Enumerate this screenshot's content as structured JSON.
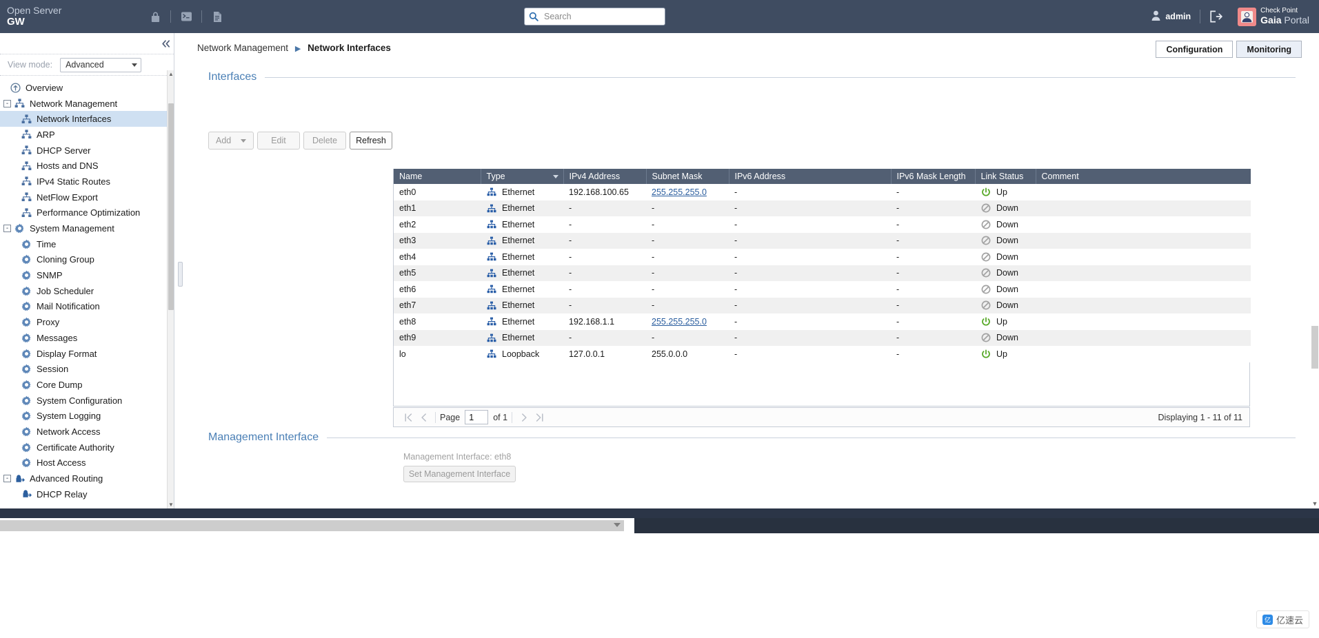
{
  "header": {
    "brand_line1": "Open Server",
    "brand_line2": "GW",
    "icons": [
      "lock-icon",
      "terminal-icon",
      "document-icon"
    ],
    "search": {
      "placeholder": "Search",
      "value": ""
    },
    "user": "admin",
    "logout_icon": "logout-icon",
    "logo": {
      "line1": "Check Point",
      "line2_bold": "Gaia",
      "line2_light": " Portal"
    },
    "bg_color": "#3f4c61"
  },
  "sidebar": {
    "collapse_icon": "collapse-left-icon",
    "view_mode": {
      "label": "View mode:",
      "value": "Advanced"
    },
    "items": [
      {
        "label": "Overview",
        "level": "root",
        "icon": "overview-icon",
        "expander": null,
        "selected": false
      },
      {
        "label": "Network Management",
        "level": "group",
        "icon": "network-icon",
        "expander": "-",
        "selected": false
      },
      {
        "label": "Network Interfaces",
        "level": "child",
        "icon": "network-icon",
        "expander": null,
        "selected": true
      },
      {
        "label": "ARP",
        "level": "child",
        "icon": "network-icon",
        "expander": null,
        "selected": false
      },
      {
        "label": "DHCP Server",
        "level": "child",
        "icon": "network-icon",
        "expander": null,
        "selected": false
      },
      {
        "label": "Hosts and DNS",
        "level": "child",
        "icon": "network-icon",
        "expander": null,
        "selected": false
      },
      {
        "label": "IPv4 Static Routes",
        "level": "child",
        "icon": "network-icon",
        "expander": null,
        "selected": false
      },
      {
        "label": "NetFlow Export",
        "level": "child",
        "icon": "network-icon",
        "expander": null,
        "selected": false
      },
      {
        "label": "Performance Optimization",
        "level": "child",
        "icon": "network-icon",
        "expander": null,
        "selected": false
      },
      {
        "label": "System Management",
        "level": "group",
        "icon": "gear-icon",
        "expander": "-",
        "selected": false
      },
      {
        "label": "Time",
        "level": "child",
        "icon": "gear-icon",
        "expander": null,
        "selected": false
      },
      {
        "label": "Cloning Group",
        "level": "child",
        "icon": "gear-icon",
        "expander": null,
        "selected": false
      },
      {
        "label": "SNMP",
        "level": "child",
        "icon": "gear-icon",
        "expander": null,
        "selected": false
      },
      {
        "label": "Job Scheduler",
        "level": "child",
        "icon": "gear-icon",
        "expander": null,
        "selected": false
      },
      {
        "label": "Mail Notification",
        "level": "child",
        "icon": "gear-icon",
        "expander": null,
        "selected": false
      },
      {
        "label": "Proxy",
        "level": "child",
        "icon": "gear-icon",
        "expander": null,
        "selected": false
      },
      {
        "label": "Messages",
        "level": "child",
        "icon": "gear-icon",
        "expander": null,
        "selected": false
      },
      {
        "label": "Display Format",
        "level": "child",
        "icon": "gear-icon",
        "expander": null,
        "selected": false
      },
      {
        "label": "Session",
        "level": "child",
        "icon": "gear-icon",
        "expander": null,
        "selected": false
      },
      {
        "label": "Core Dump",
        "level": "child",
        "icon": "gear-icon",
        "expander": null,
        "selected": false
      },
      {
        "label": "System Configuration",
        "level": "child",
        "icon": "gear-icon",
        "expander": null,
        "selected": false
      },
      {
        "label": "System Logging",
        "level": "child",
        "icon": "gear-icon",
        "expander": null,
        "selected": false
      },
      {
        "label": "Network Access",
        "level": "child",
        "icon": "gear-icon",
        "expander": null,
        "selected": false
      },
      {
        "label": "Certificate Authority",
        "level": "child",
        "icon": "gear-icon",
        "expander": null,
        "selected": false
      },
      {
        "label": "Host Access",
        "level": "child",
        "icon": "gear-icon",
        "expander": null,
        "selected": false
      },
      {
        "label": "Advanced Routing",
        "level": "group",
        "icon": "routing-lock-icon",
        "expander": "-",
        "selected": false
      },
      {
        "label": "DHCP Relay",
        "level": "child",
        "icon": "routing-lock-icon",
        "expander": null,
        "selected": false
      }
    ]
  },
  "main": {
    "breadcrumb": {
      "parent": "Network Management",
      "current": "Network Interfaces"
    },
    "mode_buttons": [
      {
        "label": "Configuration",
        "active": false
      },
      {
        "label": "Monitoring",
        "active": true
      }
    ],
    "interfaces_section": {
      "title": "Interfaces",
      "toolbar": [
        {
          "label": "Add",
          "enabled": false,
          "has_caret": true
        },
        {
          "label": "Edit",
          "enabled": false,
          "has_caret": false
        },
        {
          "label": "Delete",
          "enabled": false,
          "has_caret": false
        },
        {
          "label": "Refresh",
          "enabled": true,
          "has_caret": false
        }
      ],
      "columns": [
        "Name",
        "Type",
        "IPv4 Address",
        "Subnet Mask",
        "IPv6 Address",
        "IPv6 Mask Length",
        "Link Status",
        "Comment"
      ],
      "sorted_column": "Type",
      "rows": [
        {
          "name": "eth0",
          "type": "Ethernet",
          "ipv4": "192.168.100.65",
          "mask": "255.255.255.0",
          "mask_link": true,
          "ipv6": "-",
          "ipv6len": "-",
          "status": "Up",
          "comment": ""
        },
        {
          "name": "eth1",
          "type": "Ethernet",
          "ipv4": "-",
          "mask": "-",
          "mask_link": false,
          "ipv6": "-",
          "ipv6len": "-",
          "status": "Down",
          "comment": ""
        },
        {
          "name": "eth2",
          "type": "Ethernet",
          "ipv4": "-",
          "mask": "-",
          "mask_link": false,
          "ipv6": "-",
          "ipv6len": "-",
          "status": "Down",
          "comment": ""
        },
        {
          "name": "eth3",
          "type": "Ethernet",
          "ipv4": "-",
          "mask": "-",
          "mask_link": false,
          "ipv6": "-",
          "ipv6len": "-",
          "status": "Down",
          "comment": ""
        },
        {
          "name": "eth4",
          "type": "Ethernet",
          "ipv4": "-",
          "mask": "-",
          "mask_link": false,
          "ipv6": "-",
          "ipv6len": "-",
          "status": "Down",
          "comment": ""
        },
        {
          "name": "eth5",
          "type": "Ethernet",
          "ipv4": "-",
          "mask": "-",
          "mask_link": false,
          "ipv6": "-",
          "ipv6len": "-",
          "status": "Down",
          "comment": ""
        },
        {
          "name": "eth6",
          "type": "Ethernet",
          "ipv4": "-",
          "mask": "-",
          "mask_link": false,
          "ipv6": "-",
          "ipv6len": "-",
          "status": "Down",
          "comment": ""
        },
        {
          "name": "eth7",
          "type": "Ethernet",
          "ipv4": "-",
          "mask": "-",
          "mask_link": false,
          "ipv6": "-",
          "ipv6len": "-",
          "status": "Down",
          "comment": ""
        },
        {
          "name": "eth8",
          "type": "Ethernet",
          "ipv4": "192.168.1.1",
          "mask": "255.255.255.0",
          "mask_link": true,
          "ipv6": "-",
          "ipv6len": "-",
          "status": "Up",
          "comment": ""
        },
        {
          "name": "eth9",
          "type": "Ethernet",
          "ipv4": "-",
          "mask": "-",
          "mask_link": false,
          "ipv6": "-",
          "ipv6len": "-",
          "status": "Down",
          "comment": ""
        },
        {
          "name": "lo",
          "type": "Loopback",
          "ipv4": "127.0.0.1",
          "mask": "255.0.0.0",
          "mask_link": false,
          "ipv6": "-",
          "ipv6len": "-",
          "status": "Up",
          "comment": ""
        }
      ],
      "pager": {
        "first_icon": "first-page-icon",
        "prev_icon": "prev-page-icon",
        "page_label": "Page",
        "page_value": "1",
        "of_label": "of 1",
        "next_icon": "next-page-icon",
        "last_icon": "last-page-icon",
        "displaying": "Displaying 1 - 11 of 11"
      }
    },
    "management_section": {
      "title": "Management Interface",
      "info": "Management Interface: eth8",
      "button": "Set Management Interface"
    }
  },
  "watermark": {
    "text": "亿速云",
    "badge": "亿"
  },
  "colors": {
    "header_bg": "#3f4c61",
    "grid_header_bg": "#525f73",
    "accent_blue": "#4a7fb5",
    "link_blue": "#2a5d9e",
    "status_up": "#5aaa2b",
    "status_down": "#9e9e9e",
    "selection": "#cfe0f2"
  }
}
